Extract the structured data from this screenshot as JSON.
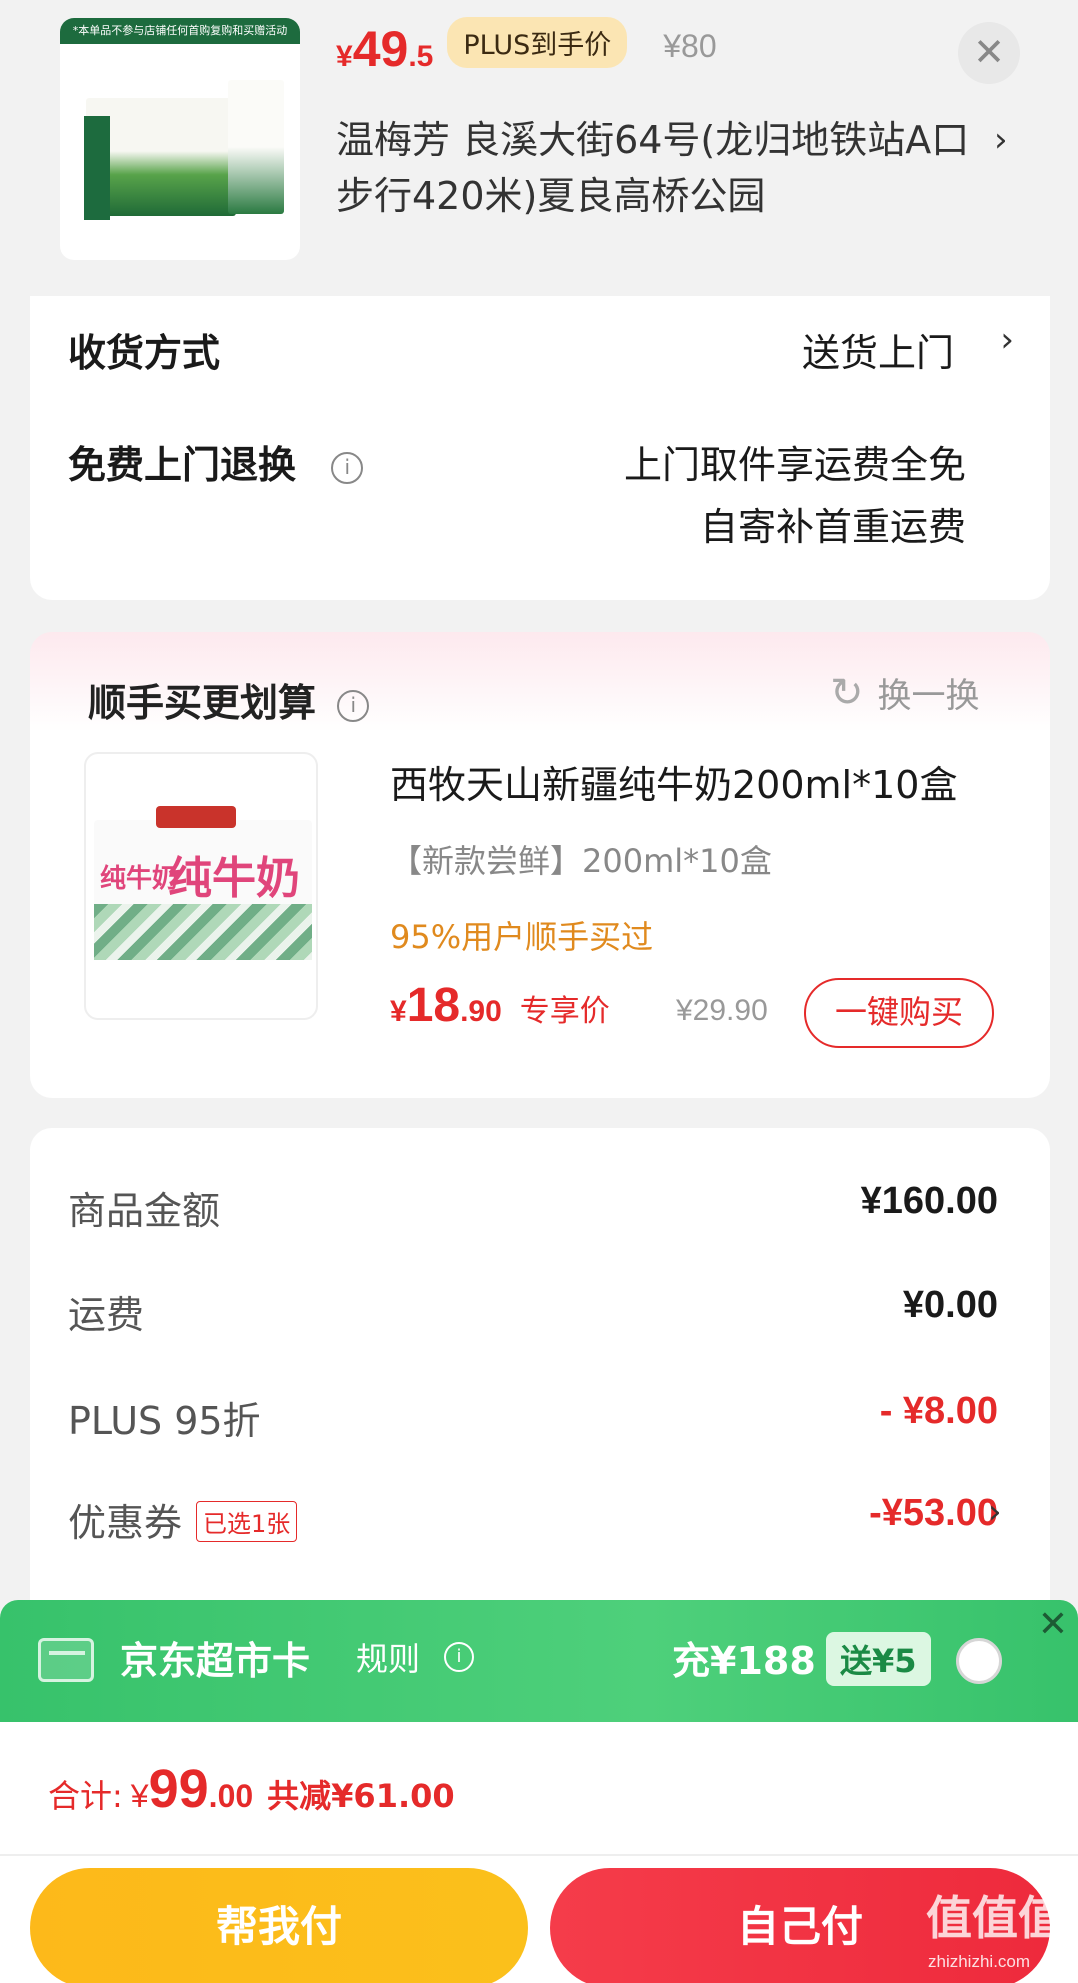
{
  "header": {
    "thumb_banner": "*本单品不参与店铺任何首购复购和买赠活动",
    "price_currency": "¥",
    "price_int": "49",
    "price_dec": ".5",
    "plus_tag": "PLUS到手价",
    "orig_price": "¥80",
    "close": "✕",
    "address": "温梅芳  良溪大街64号(龙归地铁站A口步行420米)夏良高桥公园",
    "address_chevron": "›"
  },
  "delivery": {
    "label": "收货方式",
    "value": "送货上门",
    "chevron": "›",
    "return_label": "免费上门退换",
    "info": "i",
    "return_line1": "上门取件享运费全免",
    "return_line2": "自寄补首重运费"
  },
  "addon": {
    "title": "顺手买更划算",
    "info": "i",
    "swap_icon": "↻",
    "swap_label": "换一换",
    "image_text_main": "纯牛奶",
    "image_text_side": "纯牛奶",
    "product_title": "西牧天山新疆纯牛奶200ml*10盒",
    "spec": "【新款尝鲜】200ml*10盒",
    "hint": "95%用户顺手买过",
    "price_currency": "¥",
    "price_int": "18",
    "price_dec": ".90",
    "exclusive": "专享价",
    "orig_price": "¥29.90",
    "buy_label": "一键购买"
  },
  "summary": {
    "rows": [
      {
        "label": "商品金额",
        "value": "¥160.00"
      },
      {
        "label": "运费",
        "value": "¥0.00"
      },
      {
        "label": "PLUS 95折",
        "value": "- ¥8.00"
      },
      {
        "label": "优惠券",
        "value": "-¥53.00"
      }
    ],
    "coupon_tag": "已选1张",
    "coupon_chevron": "›"
  },
  "supercard": {
    "title": "京东超市卡",
    "rule": "规则",
    "info": "i",
    "recharge": "充¥188",
    "gift": "送¥5",
    "close": "✕"
  },
  "footer": {
    "total_label": "合计:",
    "total_currency": "¥",
    "total_int": "99",
    "total_dec": ".00",
    "total_cut": "共减¥61.00",
    "help_pay": "帮我付",
    "self_pay": "自己付",
    "watermark": "值值值",
    "watermark_sub": "zhizhizhi.com"
  },
  "colors": {
    "accent_red": "#e52a2a",
    "plus_gold": "#fbe5b3",
    "green_banner": "#4ed07b",
    "help_btn": "#fdb91a",
    "self_btn": "#f53c4a"
  }
}
